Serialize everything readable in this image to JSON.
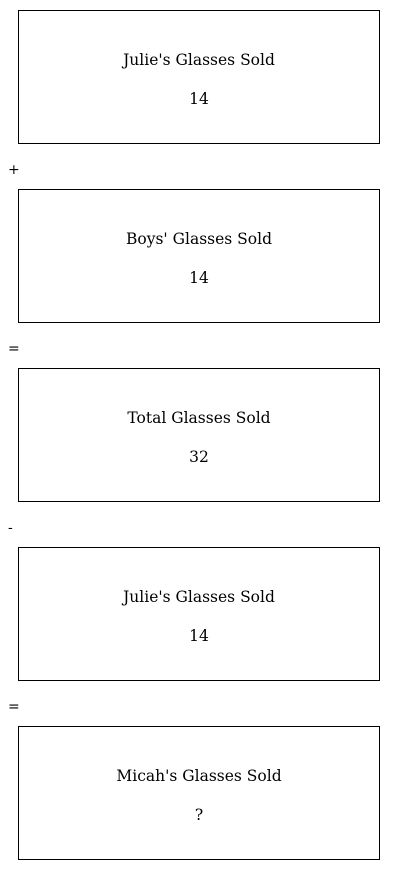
{
  "boxes": [
    {
      "label": "Julie's Glasses Sold",
      "value": "14"
    },
    {
      "label": "Boys' Glasses Sold",
      "value": "14"
    },
    {
      "label": "Total Glasses Sold",
      "value": "32"
    },
    {
      "label": "Julie's Glasses Sold",
      "value": "14"
    },
    {
      "label": "Micah's Glasses Sold",
      "value": "?"
    }
  ],
  "operators": [
    "+",
    "=",
    "-",
    "="
  ]
}
